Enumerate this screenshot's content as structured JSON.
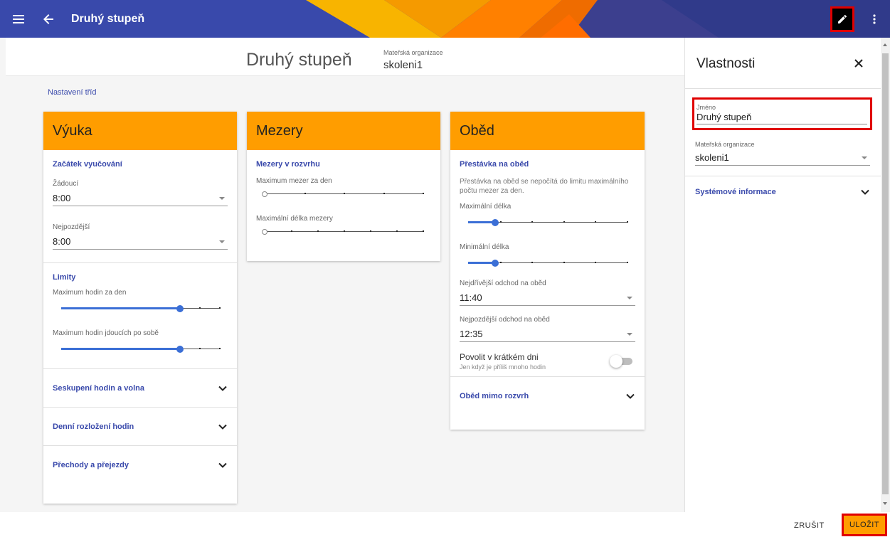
{
  "topbar": {
    "title": "Druhý stupeň",
    "accent": "#3949ab",
    "menu_icon": "hamburger-icon",
    "back_icon": "arrow-left-icon",
    "edit_icon": "pencil-icon",
    "more_icon": "more-vertical-icon"
  },
  "header": {
    "title": "Druhý stupeň",
    "org_label": "Mateřská organizace",
    "org_value": "skoleni1"
  },
  "section_link": "Nastavení tříd",
  "cards": {
    "vyuka": {
      "title": "Výuka",
      "start": {
        "title": "Začátek vyučování",
        "desired_label": "Žádoucí",
        "desired_value": "8:00",
        "latest_label": "Nejpozdější",
        "latest_value": "8:00"
      },
      "limits": {
        "title": "Limity",
        "max_per_day_label": "Maximum hodin za den",
        "max_per_day_level": 0.75,
        "max_consecutive_label": "Maximum hodin jdoucích po sobě",
        "max_consecutive_level": 0.75
      },
      "expanders": [
        "Seskupení hodin a volna",
        "Denní rozložení hodin",
        "Přechody a přejezdy"
      ]
    },
    "mezery": {
      "title": "Mezery",
      "section_title": "Mezery v rozvrhu",
      "max_gaps_label": "Maximum mezer za den",
      "max_gaps_level": 0,
      "max_gap_length_label": "Maximální délka mezery",
      "max_gap_length_level": 0
    },
    "obed": {
      "title": "Oběd",
      "section_title": "Přestávka na oběd",
      "note": "Přestávka na oběd se nepočítá do limitu maximálního počtu mezer za den.",
      "max_length_label": "Maximální délka",
      "max_length_level": 0.17,
      "min_length_label": "Minimální délka",
      "min_length_level": 0.17,
      "earliest_label": "Nejdřívější odchod na oběd",
      "earliest_value": "11:40",
      "latest_label": "Nejpozdější odchod na oběd",
      "latest_value": "12:35",
      "short_day_label": "Povolit v krátkém dni",
      "short_day_sub": "Jen když je příliš mnoho hodin",
      "expander": "Oběd mimo rozvrh"
    }
  },
  "panel": {
    "title": "Vlastnosti",
    "name_label": "Jméno",
    "name_value": "Druhý stupeň",
    "org_label": "Mateřská organizace",
    "org_value": "skoleni1",
    "sys_info": "Systémové informace"
  },
  "footer": {
    "cancel": "ZRUŠIT",
    "save": "ULOŽIT"
  },
  "colors": {
    "card_header": "#ff9d00",
    "link": "#3949ab",
    "slider": "#3b6fd6",
    "highlight": "#e00000"
  }
}
